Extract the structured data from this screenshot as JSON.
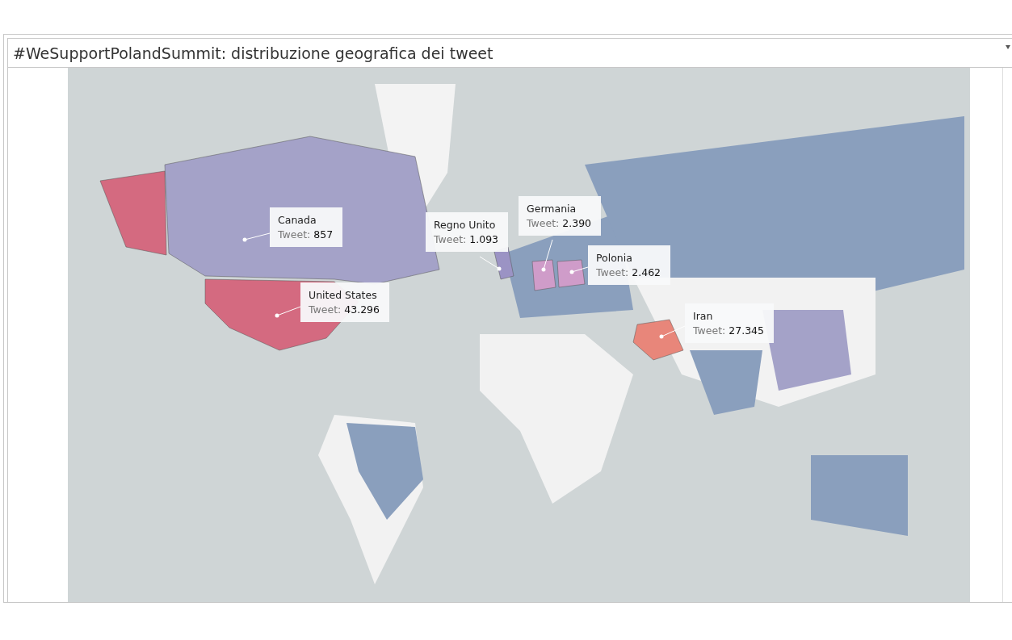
{
  "title": "#WeSupportPolandSummit: distribuzione geografica dei tweet",
  "map": {
    "callouts": [
      {
        "country": "Canada",
        "label": "Tweet:",
        "value": "857",
        "color": "#a4a2c8"
      },
      {
        "country": "United States",
        "label": "Tweet:",
        "value": "43.296",
        "color": "#d46a80"
      },
      {
        "country": "Regno Unito",
        "label": "Tweet:",
        "value": "1.093",
        "color": "#9b93c4"
      },
      {
        "country": "Germania",
        "label": "Tweet:",
        "value": "2.390",
        "color": "#cf9cc9"
      },
      {
        "country": "Polonia",
        "label": "Tweet:",
        "value": "2.462",
        "color": "#cf9cc9"
      },
      {
        "country": "Iran",
        "label": "Tweet:",
        "value": "27.345",
        "color": "#e8867a"
      }
    ]
  }
}
